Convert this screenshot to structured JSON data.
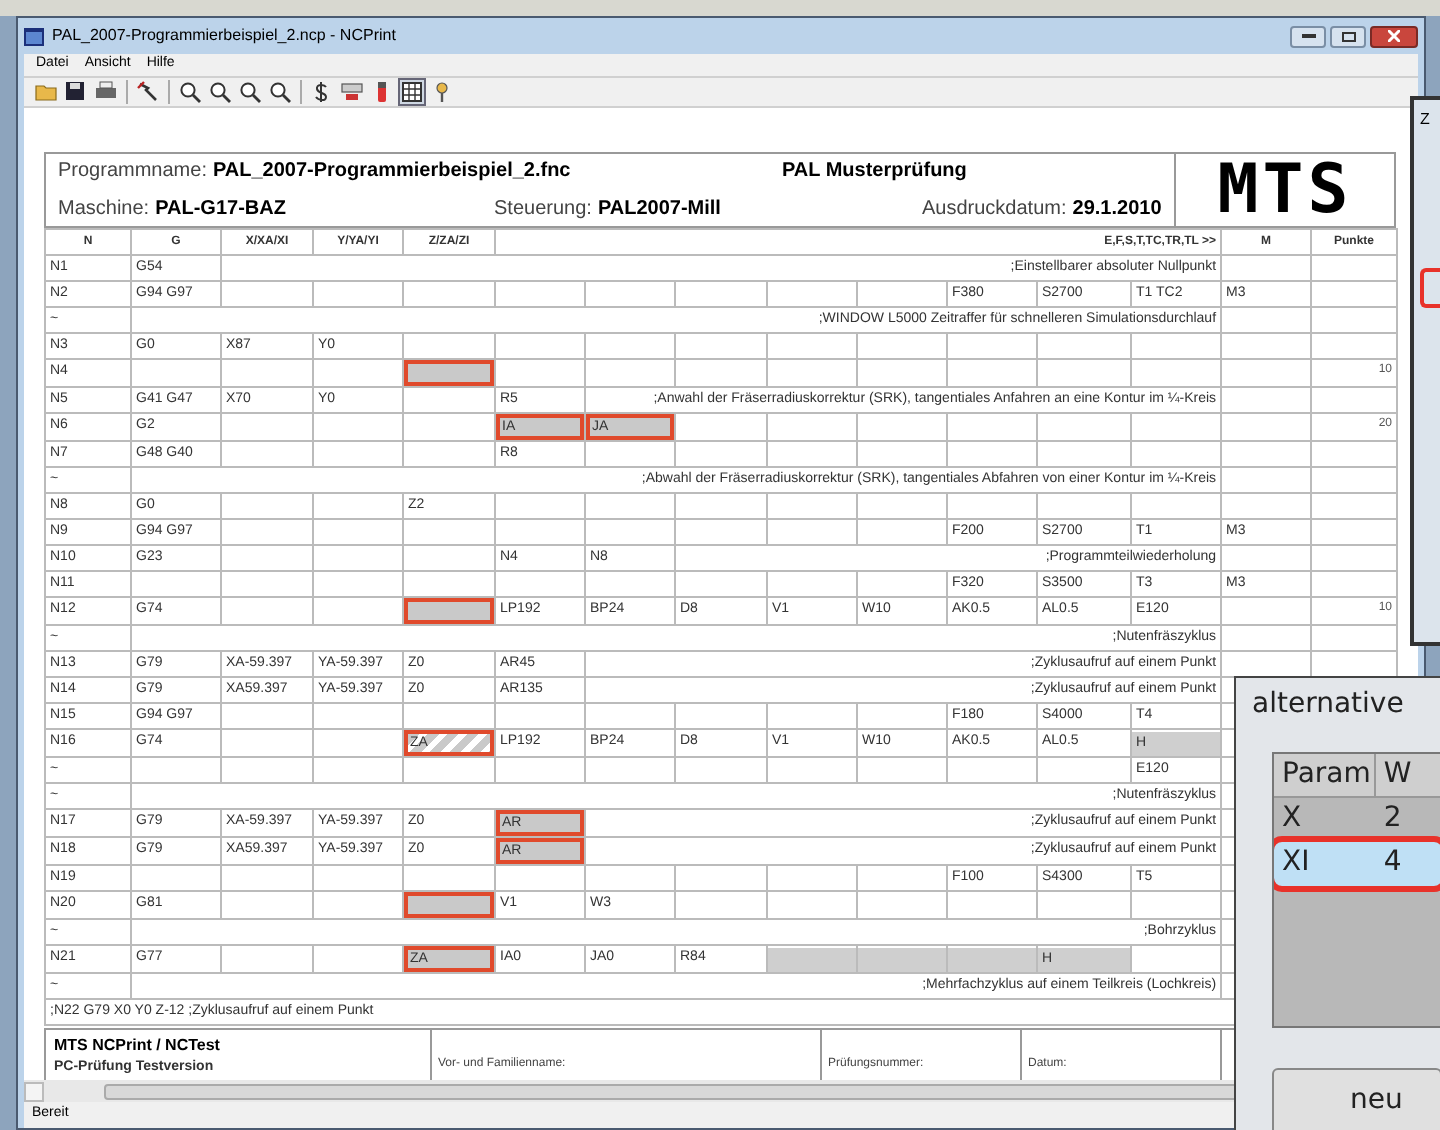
{
  "window": {
    "title": "PAL_2007-Programmierbeispiel_2.ncp - NCPrint",
    "controls": [
      {
        "kind": "minimize"
      },
      {
        "kind": "maximize"
      },
      {
        "kind": "close"
      }
    ]
  },
  "menu": [
    {
      "label": "Datei"
    },
    {
      "label": "Ansicht"
    },
    {
      "label": "Hilfe"
    }
  ],
  "toolbar": [
    {
      "kind": "open",
      "pressed": false
    },
    {
      "kind": "save",
      "pressed": false
    },
    {
      "kind": "print",
      "pressed": false
    },
    {
      "kind": "tool",
      "pressed": false
    },
    {
      "kind": "zoom",
      "pressed": false
    },
    {
      "kind": "zoom",
      "pressed": false
    },
    {
      "kind": "zoom",
      "pressed": false
    },
    {
      "kind": "zoom",
      "pressed": false
    },
    {
      "kind": "dollar",
      "pressed": false
    },
    {
      "kind": "machine",
      "pressed": false
    },
    {
      "kind": "marker",
      "pressed": false
    },
    {
      "kind": "grid",
      "pressed": true
    },
    {
      "kind": "help",
      "pressed": false
    }
  ],
  "report_header": {
    "program": {
      "label": "Programmname:",
      "value": "PAL_2007-Programmierbeispiel_2.fnc"
    },
    "exam": "PAL Musterprüfung",
    "machine": {
      "label": "Maschine:",
      "value": "PAL-G17-BAZ"
    },
    "control": {
      "label": "Steuerung:",
      "value": "PAL2007-Mill"
    },
    "print_date": {
      "label": "Ausdruckdatum:",
      "value": "29.1.2010"
    },
    "logo": "MTS"
  },
  "table": {
    "header": {
      "n": "N",
      "g": "G",
      "x": "X/XA/XI",
      "y": "Y/YA/YI",
      "z": "Z/ZA/ZI",
      "addresses": "E,F,S,T,TC,TR,TL >>",
      "m": "M",
      "points": "Punkte"
    },
    "rows": [
      {
        "n": "N1",
        "g": "G54",
        "comment": ";Einstellbarer absoluter Nullpunkt"
      },
      {
        "n": "N2",
        "g": "G94 G97",
        "column_11": {
          "text": "F380",
          "kind": "plain"
        },
        "column_12": {
          "text": "S2700",
          "kind": "plain"
        },
        "column_13": {
          "text": "T1 TC2",
          "kind": "plain"
        },
        "m": {
          "text": "M3",
          "kind": "plain"
        }
      },
      {
        "n": "~",
        "comment": ";WINDOW L5000 Zeitraffer für schnelleren Simulationsdurchlauf"
      },
      {
        "n": "N3",
        "g": "G0",
        "x": {
          "text": "X87",
          "kind": "plain"
        },
        "y": {
          "text": "Y0",
          "kind": "plain"
        }
      },
      {
        "n": "N4",
        "z": {
          "kind": "marked"
        },
        "points": "10"
      },
      {
        "n": "N5",
        "g": "G41 G47",
        "x": {
          "text": "X70",
          "kind": "plain"
        },
        "y": {
          "text": "Y0",
          "kind": "plain"
        },
        "column_6": {
          "text": "R5",
          "kind": "plain"
        },
        "comment": ";Anwahl der Fräserradiuskorrektur (SRK), tangentiales Anfahren an eine Kontur im ¼-Kreis"
      },
      {
        "n": "N6",
        "g": "G2",
        "column_6": {
          "text": "IA",
          "kind": "marked"
        },
        "column_7": {
          "text": "JA",
          "kind": "marked"
        },
        "points": "20"
      },
      {
        "n": "N7",
        "g": "G48 G40",
        "column_6": {
          "text": "R8",
          "kind": "plain"
        }
      },
      {
        "n": "~",
        "comment": ";Abwahl der Fräserradiuskorrektur (SRK), tangentiales Abfahren von einer Kontur im ¼-Kreis"
      },
      {
        "n": "N8",
        "g": "G0",
        "z": {
          "text": "Z2",
          "kind": "plain"
        }
      },
      {
        "n": "N9",
        "g": "G94 G97",
        "column_11": {
          "text": "F200",
          "kind": "plain"
        },
        "column_12": {
          "text": "S2700",
          "kind": "plain"
        },
        "column_13": {
          "text": "T1",
          "kind": "plain"
        },
        "m": {
          "text": "M3",
          "kind": "plain"
        }
      },
      {
        "n": "N10",
        "g": "G23",
        "column_6": {
          "text": "N4",
          "kind": "plain"
        },
        "column_7": {
          "text": "N8",
          "kind": "plain"
        },
        "comment": ";Programmteilwiederholung"
      },
      {
        "n": "N11",
        "column_11": {
          "text": "F320",
          "kind": "plain"
        },
        "column_12": {
          "text": "S3500",
          "kind": "plain"
        },
        "column_13": {
          "text": "T3",
          "kind": "plain"
        },
        "m": {
          "text": "M3",
          "kind": "plain"
        }
      },
      {
        "n": "N12",
        "g": "G74",
        "z": {
          "kind": "marked"
        },
        "column_6": {
          "text": "LP192",
          "kind": "plain"
        },
        "column_7": {
          "text": "BP24",
          "kind": "plain"
        },
        "column_8": {
          "text": "D8",
          "kind": "plain"
        },
        "column_9": {
          "text": "V1",
          "kind": "plain"
        },
        "column_10": {
          "text": "W10",
          "kind": "plain"
        },
        "column_11": {
          "text": "AK0.5",
          "kind": "plain"
        },
        "column_12": {
          "text": "AL0.5",
          "kind": "plain"
        },
        "column_13": {
          "text": "E120",
          "kind": "plain"
        },
        "points": "10"
      },
      {
        "n": "~",
        "comment": ";Nutenfräszyklus"
      },
      {
        "n": "N13",
        "g": "G79",
        "x": {
          "text": "XA-59.397",
          "kind": "plain"
        },
        "y": {
          "text": "YA-59.397",
          "kind": "plain"
        },
        "z": {
          "text": "Z0",
          "kind": "plain"
        },
        "column_6": {
          "text": "AR45",
          "kind": "plain"
        },
        "comment": ";Zyklusaufruf auf einem Punkt"
      },
      {
        "n": "N14",
        "g": "G79",
        "x": {
          "text": "XA59.397",
          "kind": "plain"
        },
        "y": {
          "text": "YA-59.397",
          "kind": "plain"
        },
        "z": {
          "text": "Z0",
          "kind": "plain"
        },
        "column_6": {
          "text": "AR135",
          "kind": "plain"
        },
        "comment": ";Zyklusaufruf auf einem Punkt"
      },
      {
        "n": "N15",
        "g": "G94 G97",
        "column_11": {
          "text": "F180",
          "kind": "plain"
        },
        "column_12": {
          "text": "S4000",
          "kind": "plain"
        },
        "column_13": {
          "text": "T4",
          "kind": "plain"
        }
      },
      {
        "n": "N16",
        "g": "G74",
        "z": {
          "text": "ZA",
          "kind": "marked-hatched"
        },
        "column_6": {
          "text": "LP192",
          "kind": "plain"
        },
        "column_7": {
          "text": "BP24",
          "kind": "plain"
        },
        "column_8": {
          "text": "D8",
          "kind": "plain"
        },
        "column_9": {
          "text": "V1",
          "kind": "plain"
        },
        "column_10": {
          "text": "W10",
          "kind": "plain"
        },
        "column_11": {
          "text": "AK0.5",
          "kind": "plain"
        },
        "column_12": {
          "text": "AL0.5",
          "kind": "plain"
        },
        "column_13": {
          "text": "H",
          "kind": "shaded"
        }
      },
      {
        "n": "~",
        "column_13": {
          "text": "E120",
          "kind": "plain"
        }
      },
      {
        "n": "~",
        "comment": ";Nutenfräszyklus"
      },
      {
        "n": "N17",
        "g": "G79",
        "x": {
          "text": "XA-59.397",
          "kind": "plain"
        },
        "y": {
          "text": "YA-59.397",
          "kind": "plain"
        },
        "z": {
          "text": "Z0",
          "kind": "plain"
        },
        "column_6": {
          "text": "AR",
          "kind": "marked"
        },
        "comment": ";Zyklusaufruf auf einem Punkt"
      },
      {
        "n": "N18",
        "g": "G79",
        "x": {
          "text": "XA59.397",
          "kind": "plain"
        },
        "y": {
          "text": "YA-59.397",
          "kind": "plain"
        },
        "z": {
          "text": "Z0",
          "kind": "plain"
        },
        "column_6": {
          "text": "AR",
          "kind": "marked"
        },
        "comment": ";Zyklusaufruf auf einem Punkt"
      },
      {
        "n": "N19",
        "column_11": {
          "text": "F100",
          "kind": "plain"
        },
        "column_12": {
          "text": "S4300",
          "kind": "plain"
        },
        "column_13": {
          "text": "T5",
          "kind": "plain"
        }
      },
      {
        "n": "N20",
        "g": "G81",
        "z": {
          "kind": "marked"
        },
        "column_6": {
          "text": "V1",
          "kind": "plain"
        },
        "column_7": {
          "text": "W3",
          "kind": "plain"
        }
      },
      {
        "n": "~",
        "comment": ";Bohrzyklus"
      },
      {
        "n": "N21",
        "g": "G77",
        "z": {
          "text": "ZA",
          "kind": "marked"
        },
        "column_6": {
          "text": "IA0",
          "kind": "plain"
        },
        "column_7": {
          "text": "JA0",
          "kind": "plain"
        },
        "column_8": {
          "text": "R84",
          "kind": "plain"
        },
        "column_9": {
          "kind": "shaded"
        },
        "column_10": {
          "kind": "shaded"
        },
        "column_11": {
          "kind": "shaded"
        },
        "column_12": {
          "text": "H",
          "kind": "shaded"
        }
      },
      {
        "n": "~",
        "comment": ";Mehrfachzyklus auf einem Teilkreis (Lochkreis)"
      }
    ],
    "trailing_line": ";N22 G79 X0 Y0 Z-12 ;Zyklusaufruf auf einem Punkt"
  },
  "footer": {
    "title": "MTS NCPrint / NCTest",
    "subtitle": "PC-Prüfung Testversion",
    "fields": [
      "Vor- und Familienname:",
      "Prüfungsnummer:",
      "Datum:"
    ]
  },
  "status_bar": "Bereit",
  "side_dialog": {
    "title": "Z"
  },
  "alternative_dialog": {
    "title": "alternative",
    "columns": [
      "Param",
      "W"
    ],
    "rows": [
      {
        "param": "X",
        "value": "2",
        "selected": false
      },
      {
        "param": "XI",
        "value": "4",
        "selected": true
      }
    ],
    "button": "neu"
  }
}
